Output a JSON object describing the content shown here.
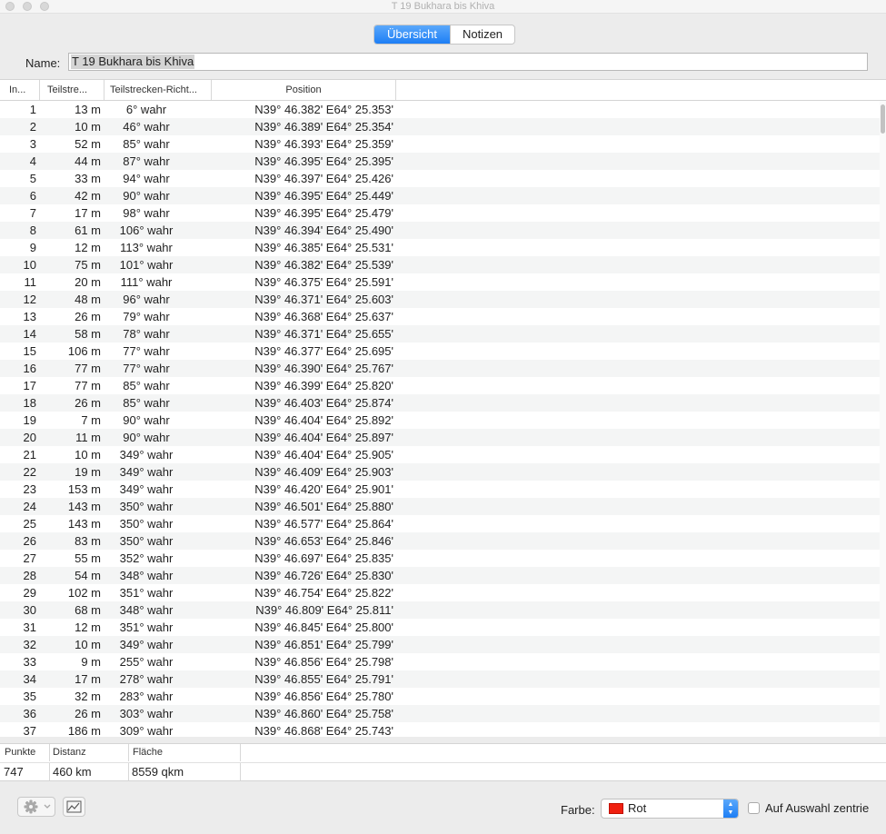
{
  "window": {
    "title": "T 19 Bukhara bis Khiva"
  },
  "tabs": [
    {
      "label": "Übersicht"
    },
    {
      "label": "Notizen"
    }
  ],
  "name": {
    "label": "Name:",
    "value": "T 19 Bukhara bis Khiva"
  },
  "table": {
    "columns": [
      "In...",
      "Teilstre...",
      "Teilstrecken-Richt...",
      "Position"
    ],
    "rows": [
      [
        "1",
        "13 m",
        "6° wahr",
        "N39° 46.382' E64° 25.353'"
      ],
      [
        "2",
        "10 m",
        "46° wahr",
        "N39° 46.389' E64° 25.354'"
      ],
      [
        "3",
        "52 m",
        "85° wahr",
        "N39° 46.393' E64° 25.359'"
      ],
      [
        "4",
        "44 m",
        "87° wahr",
        "N39° 46.395' E64° 25.395'"
      ],
      [
        "5",
        "33 m",
        "94° wahr",
        "N39° 46.397' E64° 25.426'"
      ],
      [
        "6",
        "42 m",
        "90° wahr",
        "N39° 46.395' E64° 25.449'"
      ],
      [
        "7",
        "17 m",
        "98° wahr",
        "N39° 46.395' E64° 25.479'"
      ],
      [
        "8",
        "61 m",
        "106° wahr",
        "N39° 46.394' E64° 25.490'"
      ],
      [
        "9",
        "12 m",
        "113° wahr",
        "N39° 46.385' E64° 25.531'"
      ],
      [
        "10",
        "75 m",
        "101° wahr",
        "N39° 46.382' E64° 25.539'"
      ],
      [
        "11",
        "20 m",
        "111° wahr",
        "N39° 46.375' E64° 25.591'"
      ],
      [
        "12",
        "48 m",
        "96° wahr",
        "N39° 46.371' E64° 25.603'"
      ],
      [
        "13",
        "26 m",
        "79° wahr",
        "N39° 46.368' E64° 25.637'"
      ],
      [
        "14",
        "58 m",
        "78° wahr",
        "N39° 46.371' E64° 25.655'"
      ],
      [
        "15",
        "106 m",
        "77° wahr",
        "N39° 46.377' E64° 25.695'"
      ],
      [
        "16",
        "77 m",
        "77° wahr",
        "N39° 46.390' E64° 25.767'"
      ],
      [
        "17",
        "77 m",
        "85° wahr",
        "N39° 46.399' E64° 25.820'"
      ],
      [
        "18",
        "26 m",
        "85° wahr",
        "N39° 46.403' E64° 25.874'"
      ],
      [
        "19",
        "7 m",
        "90° wahr",
        "N39° 46.404' E64° 25.892'"
      ],
      [
        "20",
        "11 m",
        "90° wahr",
        "N39° 46.404' E64° 25.897'"
      ],
      [
        "21",
        "10 m",
        "349° wahr",
        "N39° 46.404' E64° 25.905'"
      ],
      [
        "22",
        "19 m",
        "349° wahr",
        "N39° 46.409' E64° 25.903'"
      ],
      [
        "23",
        "153 m",
        "349° wahr",
        "N39° 46.420' E64° 25.901'"
      ],
      [
        "24",
        "143 m",
        "350° wahr",
        "N39° 46.501' E64° 25.880'"
      ],
      [
        "25",
        "143 m",
        "350° wahr",
        "N39° 46.577' E64° 25.864'"
      ],
      [
        "26",
        "83 m",
        "350° wahr",
        "N39° 46.653' E64° 25.846'"
      ],
      [
        "27",
        "55 m",
        "352° wahr",
        "N39° 46.697' E64° 25.835'"
      ],
      [
        "28",
        "54 m",
        "348° wahr",
        "N39° 46.726' E64° 25.830'"
      ],
      [
        "29",
        "102 m",
        "351° wahr",
        "N39° 46.754' E64° 25.822'"
      ],
      [
        "30",
        "68 m",
        "348° wahr",
        "N39° 46.809' E64° 25.811'"
      ],
      [
        "31",
        "12 m",
        "351° wahr",
        "N39° 46.845' E64° 25.800'"
      ],
      [
        "32",
        "10 m",
        "349° wahr",
        "N39° 46.851' E64° 25.799'"
      ],
      [
        "33",
        "9 m",
        "255° wahr",
        "N39° 46.856' E64° 25.798'"
      ],
      [
        "34",
        "17 m",
        "278° wahr",
        "N39° 46.855' E64° 25.791'"
      ],
      [
        "35",
        "32 m",
        "283° wahr",
        "N39° 46.856' E64° 25.780'"
      ],
      [
        "36",
        "26 m",
        "303° wahr",
        "N39° 46.860' E64° 25.758'"
      ],
      [
        "37",
        "186 m",
        "309° wahr",
        "N39° 46.868' E64° 25.743'"
      ]
    ]
  },
  "stats": {
    "headers": [
      "Punkte",
      "Distanz",
      "Fläche"
    ],
    "values": [
      "747",
      "460 km",
      "8559 qkm"
    ]
  },
  "bottom": {
    "gear_icon": "gear-icon",
    "chart_icon": "chart-icon",
    "color_label": "Farbe:",
    "color_value": "Rot",
    "color_swatch": "#f02010",
    "checkbox_label": "Auf Auswahl zentrie"
  }
}
